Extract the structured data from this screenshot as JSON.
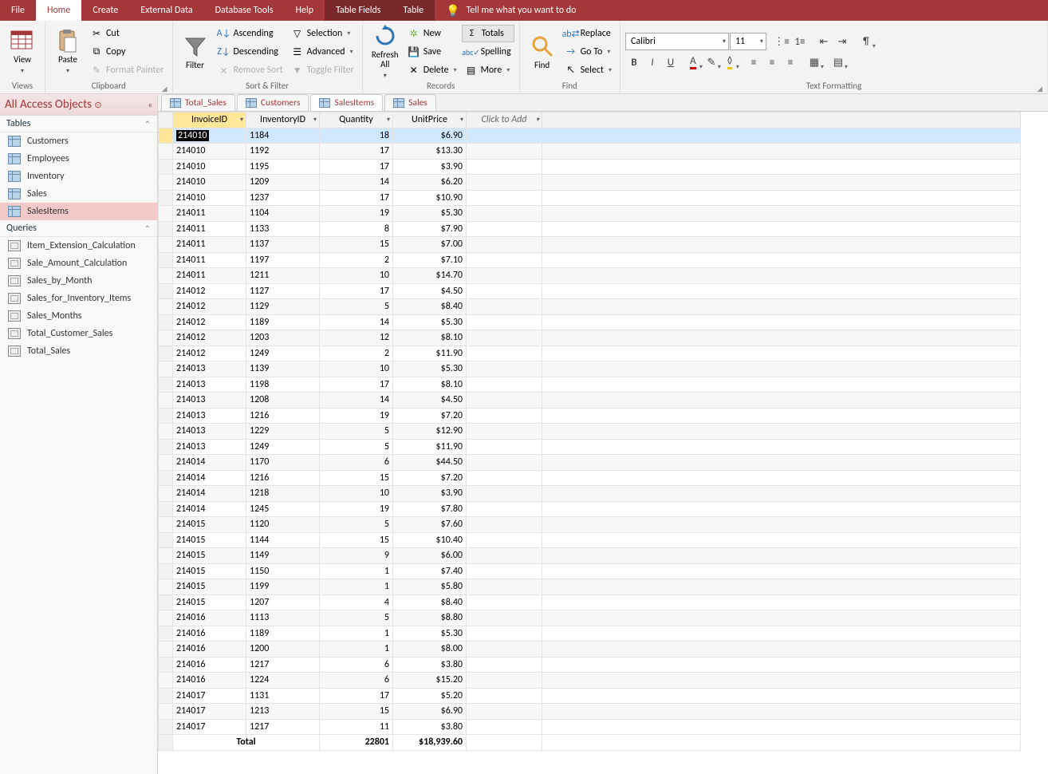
{
  "ribbon": {
    "tabs": [
      "File",
      "Home",
      "Create",
      "External Data",
      "Database Tools",
      "Help",
      "Table Fields",
      "Table"
    ],
    "active_tab": "Home",
    "tell_me": "Tell me what you want to do",
    "groups": {
      "views": {
        "label": "Views",
        "view": "View"
      },
      "clipboard": {
        "label": "Clipboard",
        "paste": "Paste",
        "cut": "Cut",
        "copy": "Copy",
        "format_painter": "Format Painter"
      },
      "sortfilter": {
        "label": "Sort & Filter",
        "filter": "Filter",
        "asc": "Ascending",
        "desc": "Descending",
        "remove": "Remove Sort",
        "selection": "Selection",
        "advanced": "Advanced",
        "toggle": "Toggle Filter"
      },
      "records": {
        "label": "Records",
        "refresh": "Refresh All",
        "new": "New",
        "save": "Save",
        "delete": "Delete",
        "totals": "Totals",
        "spelling": "Spelling",
        "more": "More"
      },
      "find": {
        "label": "Find",
        "find": "Find",
        "replace": "Replace",
        "goto": "Go To",
        "select": "Select"
      },
      "textfmt": {
        "label": "Text Formatting",
        "font": "Calibri",
        "size": "11"
      }
    }
  },
  "nav": {
    "title": "All Access Objects",
    "sections": [
      {
        "label": "Tables",
        "items": [
          "Customers",
          "Employees",
          "Inventory",
          "Sales",
          "SalesItems"
        ],
        "selected": "SalesItems",
        "icon": "table"
      },
      {
        "label": "Queries",
        "items": [
          "Item_Extension_Calculation",
          "Sale_Amount_Calculation",
          "Sales_by_Month",
          "Sales_for_Inventory_Items",
          "Sales_Months",
          "Total_Customer_Sales",
          "Total_Sales"
        ],
        "icon": "query"
      }
    ]
  },
  "doc_tabs": {
    "tabs": [
      "Total_Sales",
      "Customers",
      "SalesItems",
      "Sales"
    ],
    "active": "SalesItems"
  },
  "table": {
    "columns": [
      "InvoiceID",
      "InventoryID",
      "Quantity",
      "UnitPrice"
    ],
    "add_column": "Click to Add",
    "active_column": "InvoiceID",
    "editing_value": "214010",
    "rows": [
      {
        "InvoiceID": "214010",
        "InventoryID": "1184",
        "Quantity": 18,
        "UnitPrice": "$6.90",
        "selected": true,
        "editing": true
      },
      {
        "InvoiceID": "214010",
        "InventoryID": "1192",
        "Quantity": 17,
        "UnitPrice": "$13.30"
      },
      {
        "InvoiceID": "214010",
        "InventoryID": "1195",
        "Quantity": 17,
        "UnitPrice": "$3.90"
      },
      {
        "InvoiceID": "214010",
        "InventoryID": "1209",
        "Quantity": 14,
        "UnitPrice": "$6.20"
      },
      {
        "InvoiceID": "214010",
        "InventoryID": "1237",
        "Quantity": 17,
        "UnitPrice": "$10.90"
      },
      {
        "InvoiceID": "214011",
        "InventoryID": "1104",
        "Quantity": 19,
        "UnitPrice": "$5.30"
      },
      {
        "InvoiceID": "214011",
        "InventoryID": "1133",
        "Quantity": 8,
        "UnitPrice": "$7.90"
      },
      {
        "InvoiceID": "214011",
        "InventoryID": "1137",
        "Quantity": 15,
        "UnitPrice": "$7.00"
      },
      {
        "InvoiceID": "214011",
        "InventoryID": "1197",
        "Quantity": 2,
        "UnitPrice": "$7.10"
      },
      {
        "InvoiceID": "214011",
        "InventoryID": "1211",
        "Quantity": 10,
        "UnitPrice": "$14.70"
      },
      {
        "InvoiceID": "214012",
        "InventoryID": "1127",
        "Quantity": 17,
        "UnitPrice": "$4.50"
      },
      {
        "InvoiceID": "214012",
        "InventoryID": "1129",
        "Quantity": 5,
        "UnitPrice": "$8.40"
      },
      {
        "InvoiceID": "214012",
        "InventoryID": "1189",
        "Quantity": 14,
        "UnitPrice": "$5.30"
      },
      {
        "InvoiceID": "214012",
        "InventoryID": "1203",
        "Quantity": 12,
        "UnitPrice": "$8.10"
      },
      {
        "InvoiceID": "214012",
        "InventoryID": "1249",
        "Quantity": 2,
        "UnitPrice": "$11.90"
      },
      {
        "InvoiceID": "214013",
        "InventoryID": "1139",
        "Quantity": 10,
        "UnitPrice": "$5.30"
      },
      {
        "InvoiceID": "214013",
        "InventoryID": "1198",
        "Quantity": 17,
        "UnitPrice": "$8.10"
      },
      {
        "InvoiceID": "214013",
        "InventoryID": "1208",
        "Quantity": 14,
        "UnitPrice": "$4.50"
      },
      {
        "InvoiceID": "214013",
        "InventoryID": "1216",
        "Quantity": 19,
        "UnitPrice": "$7.20"
      },
      {
        "InvoiceID": "214013",
        "InventoryID": "1229",
        "Quantity": 5,
        "UnitPrice": "$12.90"
      },
      {
        "InvoiceID": "214013",
        "InventoryID": "1249",
        "Quantity": 5,
        "UnitPrice": "$11.90"
      },
      {
        "InvoiceID": "214014",
        "InventoryID": "1170",
        "Quantity": 6,
        "UnitPrice": "$44.50"
      },
      {
        "InvoiceID": "214014",
        "InventoryID": "1216",
        "Quantity": 15,
        "UnitPrice": "$7.20"
      },
      {
        "InvoiceID": "214014",
        "InventoryID": "1218",
        "Quantity": 10,
        "UnitPrice": "$3.90"
      },
      {
        "InvoiceID": "214014",
        "InventoryID": "1245",
        "Quantity": 19,
        "UnitPrice": "$7.80"
      },
      {
        "InvoiceID": "214015",
        "InventoryID": "1120",
        "Quantity": 5,
        "UnitPrice": "$7.60"
      },
      {
        "InvoiceID": "214015",
        "InventoryID": "1144",
        "Quantity": 15,
        "UnitPrice": "$10.40"
      },
      {
        "InvoiceID": "214015",
        "InventoryID": "1149",
        "Quantity": 9,
        "UnitPrice": "$6.00"
      },
      {
        "InvoiceID": "214015",
        "InventoryID": "1150",
        "Quantity": 1,
        "UnitPrice": "$7.40"
      },
      {
        "InvoiceID": "214015",
        "InventoryID": "1199",
        "Quantity": 1,
        "UnitPrice": "$5.80"
      },
      {
        "InvoiceID": "214015",
        "InventoryID": "1207",
        "Quantity": 4,
        "UnitPrice": "$8.40"
      },
      {
        "InvoiceID": "214016",
        "InventoryID": "1113",
        "Quantity": 5,
        "UnitPrice": "$8.80"
      },
      {
        "InvoiceID": "214016",
        "InventoryID": "1189",
        "Quantity": 1,
        "UnitPrice": "$5.30"
      },
      {
        "InvoiceID": "214016",
        "InventoryID": "1200",
        "Quantity": 1,
        "UnitPrice": "$8.00"
      },
      {
        "InvoiceID": "214016",
        "InventoryID": "1217",
        "Quantity": 6,
        "UnitPrice": "$3.80"
      },
      {
        "InvoiceID": "214016",
        "InventoryID": "1224",
        "Quantity": 6,
        "UnitPrice": "$15.20"
      },
      {
        "InvoiceID": "214017",
        "InventoryID": "1131",
        "Quantity": 17,
        "UnitPrice": "$5.20"
      },
      {
        "InvoiceID": "214017",
        "InventoryID": "1213",
        "Quantity": 15,
        "UnitPrice": "$6.90"
      },
      {
        "InvoiceID": "214017",
        "InventoryID": "1217",
        "Quantity": 11,
        "UnitPrice": "$3.80"
      }
    ],
    "totals": {
      "label": "Total",
      "Quantity": "22801",
      "UnitPrice": "$18,939.60"
    }
  }
}
